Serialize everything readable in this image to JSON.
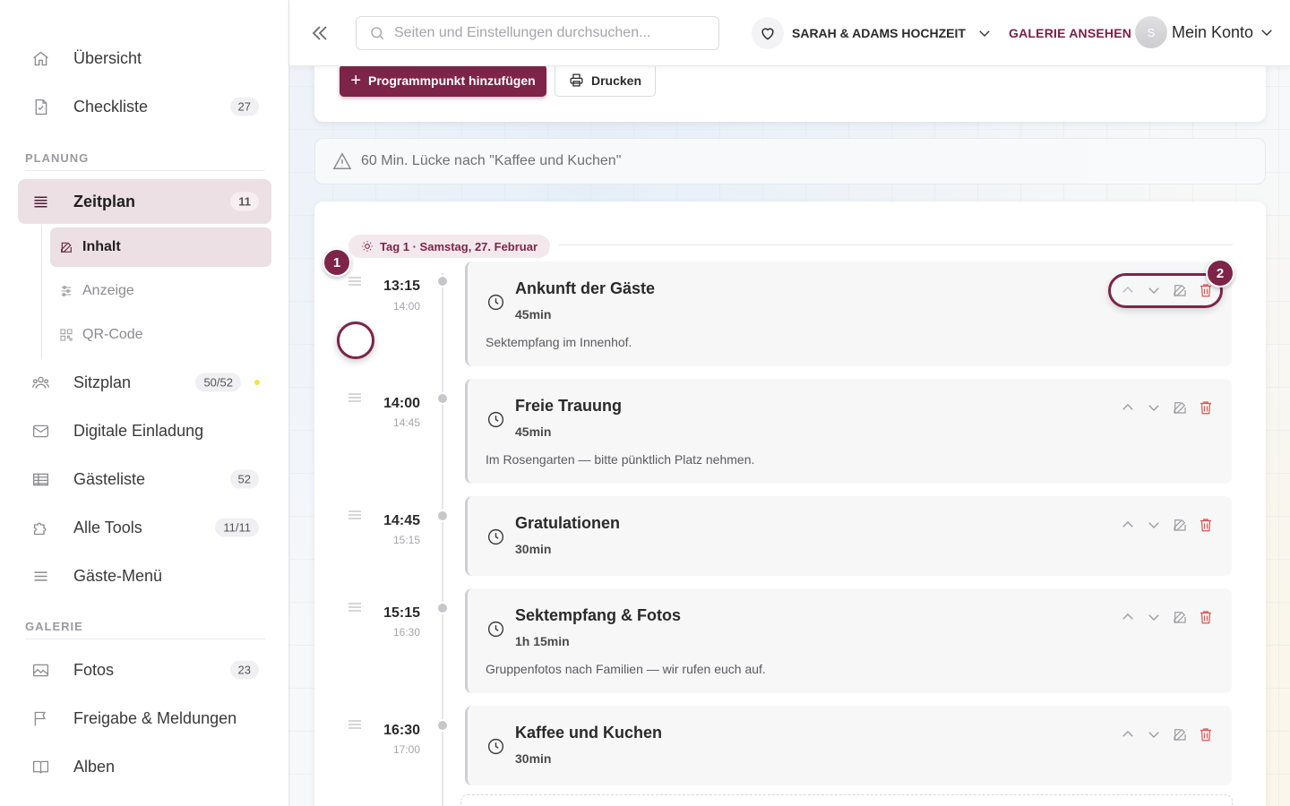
{
  "sidebar": {
    "items": [
      {
        "label": "Übersicht"
      },
      {
        "label": "Checkliste",
        "badge": "27"
      },
      {
        "label": "Zeitplan",
        "badge": "11"
      },
      {
        "label": "Sitzplan",
        "badge": "50/52"
      },
      {
        "label": "Digitale Einladung"
      },
      {
        "label": "Gästeliste",
        "badge": "52"
      },
      {
        "label": "Alle Tools",
        "badge": "11/11"
      },
      {
        "label": "Gäste-Menü"
      },
      {
        "label": "Fotos",
        "badge": "23"
      },
      {
        "label": "Freigabe & Meldungen"
      },
      {
        "label": "Alben"
      }
    ],
    "sections": {
      "planung": "PLANUNG",
      "galerie": "GALERIE"
    },
    "subitems": [
      {
        "label": "Inhalt"
      },
      {
        "label": "Anzeige"
      },
      {
        "label": "QR-Code"
      }
    ]
  },
  "topbar": {
    "search_placeholder": "Seiten und Einstellungen durchsuchen...",
    "wedding": "SARAH & ADAMS HOCHZEIT",
    "gallery_link": "GALERIE ANSEHEN",
    "avatar_initial": "S",
    "account": "Mein Konto"
  },
  "toolbar": {
    "add_label": "Programmpunkt hinzufügen",
    "print_label": "Drucken"
  },
  "warning": "60 Min. Lücke nach \"Kaffee und Kuchen\"",
  "day_label": "Tag 1 · Samstag, 27. Februar",
  "markers": {
    "one": "1",
    "two": "2"
  },
  "events": [
    {
      "start": "13:15",
      "end": "14:00",
      "title": "Ankunft der Gäste",
      "duration": "45min",
      "description": "Sektempfang im Innenhof."
    },
    {
      "start": "14:00",
      "end": "14:45",
      "title": "Freie Trauung",
      "duration": "45min",
      "description": "Im Rosengarten — bitte pünktlich Platz nehmen."
    },
    {
      "start": "14:45",
      "end": "15:15",
      "title": "Gratulationen",
      "duration": "30min",
      "description": ""
    },
    {
      "start": "15:15",
      "end": "16:30",
      "title": "Sektempfang & Fotos",
      "duration": "1h 15min",
      "description": "Gruppenfotos nach Familien — wir rufen euch auf."
    },
    {
      "start": "16:30",
      "end": "17:00",
      "title": "Kaffee und Kuchen",
      "duration": "30min",
      "description": ""
    }
  ],
  "colors": {
    "accent": "#7d2448",
    "active_bg": "#ece0e4",
    "delete": "#d9534f"
  }
}
